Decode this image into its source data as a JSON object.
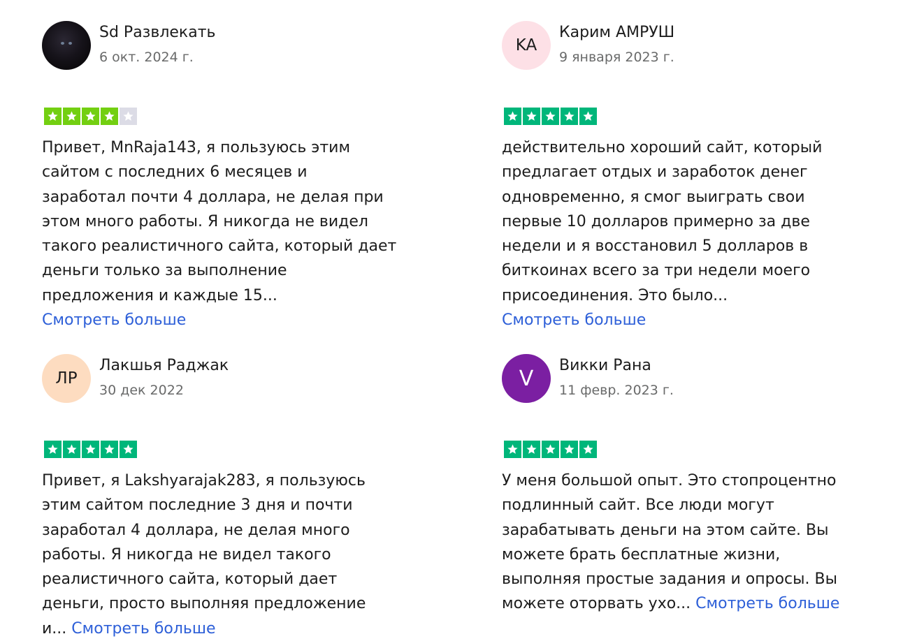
{
  "reviews": [
    {
      "name": "Sd Развлекать",
      "date": "6 окт. 2024 г.",
      "avatar": {
        "type": "photo",
        "initials": ""
      },
      "rating": 4,
      "star_color": "#73cf11",
      "text": "Привет, MnRaja143, я пользуюсь этим\nсайтом с последних 6 месяцев и\nзаработал почти 4 доллара, не делая при\nэтом много работы. Я никогда не видел\nтакого реалистичного сайта, который дает\nденьги только за выполнение\nпредложения и каждые 15...\n",
      "more": "Смотреть больше"
    },
    {
      "name": "Карим АМРУШ",
      "date": "9 января 2023 г.",
      "avatar": {
        "type": "initials",
        "initials": "KA",
        "bg": "#fde0e6"
      },
      "rating": 5,
      "star_color": "#00b67a",
      "text": "действительно хороший сайт, который\nпредлагает отдых и заработок денег\nодновременно, я смог выиграть свои\nпервые 10 долларов примерно за две\nнедели и я восстановил 5 долларов в\nбиткоинах всего за три недели моего\nприсоединения. Это было...\n",
      "more": "Смотреть больше"
    },
    {
      "name": "Лакшья Раджак",
      "date": "30 дек 2022",
      "avatar": {
        "type": "initials",
        "initials": "ЛР",
        "bg": "#fddcc0"
      },
      "rating": 5,
      "star_color": "#00b67a",
      "text": "Привет, я Lakshyarajak283, я пользуюсь\nэтим сайтом последние 3 дня и почти\nзаработал 4 доллара, не делая много\nработы. Я никогда не видел такого\nреалистичного сайта, который дает\nденьги, просто выполняя предложение\nи... ",
      "more": "Смотреть больше"
    },
    {
      "name": "Викки Рана",
      "date": "11 февр. 2023 г.",
      "avatar": {
        "type": "initials",
        "initials": "V",
        "bg": "#7b1fa2"
      },
      "rating": 5,
      "star_color": "#00b67a",
      "text": "У меня большой опыт. Это стопроцентно\nподлинный сайт. Все люди могут\nзарабатывать деньги на этом сайте. Вы\nможете брать бесплатные жизни,\nвыполняя простые задания и опросы. Вы\nможете оторвать ухо... ",
      "more": "Смотреть больше"
    }
  ],
  "empty_star_color": "#dcdce6",
  "icons": {
    "star": "star-icon"
  }
}
